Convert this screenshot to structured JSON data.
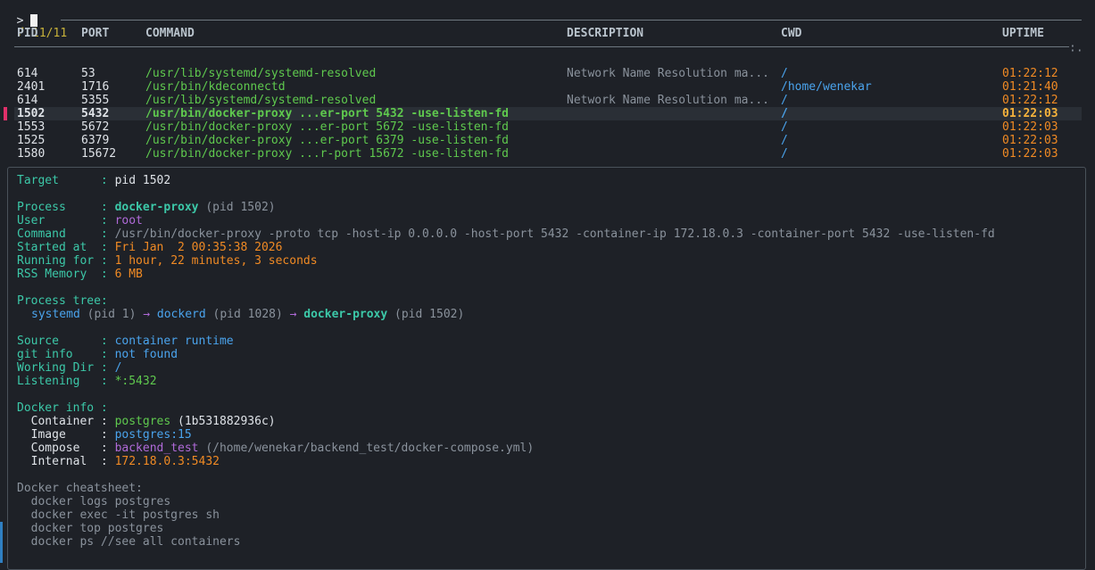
{
  "prompt": {
    "symbol": ">"
  },
  "counter": {
    "icon": "⠌",
    "text": "11/11"
  },
  "columns": [
    "PID",
    "PORT",
    "COMMAND",
    "DESCRIPTION",
    "CWD",
    "UPTIME"
  ],
  "rows": [
    {
      "pid": "614",
      "port": "53",
      "command": "/usr/lib/systemd/systemd-resolved",
      "description": "Network Name Resolution ma...",
      "cwd": "/",
      "uptime": "01:22:12"
    },
    {
      "pid": "2401",
      "port": "1716",
      "command": "/usr/bin/kdeconnectd",
      "description": "",
      "cwd": "/home/wenekar",
      "uptime": "01:21:40"
    },
    {
      "pid": "614",
      "port": "5355",
      "command": "/usr/lib/systemd/systemd-resolved",
      "description": "Network Name Resolution ma...",
      "cwd": "/",
      "uptime": "01:22:12"
    },
    {
      "pid": "1502",
      "port": "5432",
      "command": "/usr/bin/docker-proxy ...er-port 5432 -use-listen-fd",
      "description": "",
      "cwd": "/",
      "uptime": "01:22:03"
    },
    {
      "pid": "1553",
      "port": "5672",
      "command": "/usr/bin/docker-proxy ...er-port 5672 -use-listen-fd",
      "description": "",
      "cwd": "/",
      "uptime": "01:22:03"
    },
    {
      "pid": "1525",
      "port": "6379",
      "command": "/usr/bin/docker-proxy ...er-port 6379 -use-listen-fd",
      "description": "",
      "cwd": "/",
      "uptime": "01:22:03"
    },
    {
      "pid": "1580",
      "port": "15672",
      "command": "/usr/bin/docker-proxy ...r-port 15672 -use-listen-fd",
      "description": "",
      "cwd": "/",
      "uptime": "01:22:03"
    }
  ],
  "detail": {
    "target_label": "Target      :",
    "target_value": "pid 1502",
    "process_label": "Process     :",
    "process_name": "docker-proxy",
    "process_pid": " (pid 1502)",
    "user_label": "User        :",
    "user_value": "root",
    "command_label": "Command     :",
    "command_value": "/usr/bin/docker-proxy -proto tcp -host-ip 0.0.0.0 -host-port 5432 -container-ip 172.18.0.3 -container-port 5432 -use-listen-fd",
    "started_label": "Started at  :",
    "started_value": "Fri Jan  2 00:35:38 2026",
    "running_label": "Running for :",
    "running_value": "1 hour, 22 minutes, 3 seconds",
    "rss_label": "RSS Memory  :",
    "rss_value": "6 MB",
    "tree_label": "Process tree:",
    "tree": {
      "n1": "systemd",
      "p1": " (pid 1) ",
      "arrow": "→",
      "n2": "dockerd",
      "p2": " (pid 1028) ",
      "n3": "docker-proxy",
      "p3": " (pid 1502)"
    },
    "source_label": "Source      :",
    "source_value": "container runtime",
    "git_label": "git info    :",
    "git_value": "not found",
    "wd_label": "Working Dir :",
    "wd_value": "/",
    "listening_label": "Listening   :",
    "listening_value": "*:5432",
    "docker_label": "Docker info :",
    "container_label": "  Container :",
    "container_value": "postgres",
    "container_id": " (1b531882936c)",
    "image_label": "  Image     :",
    "image_value": "postgres:15",
    "compose_label": "  Compose   :",
    "compose_value": "backend_test",
    "compose_path": " (/home/wenekar/backend_test/docker-compose.yml)",
    "internal_label": "  Internal  :",
    "internal_value": "172.18.0.3:5432",
    "cheat_label": "Docker cheatsheet:",
    "cheats": [
      "  docker logs postgres",
      "  docker exec -it postgres sh",
      "  docker top postgres",
      "  docker ps //see all containers"
    ]
  },
  "colors": {
    "accent": "#3cc8a8",
    "selection_marker": "#e0306a",
    "command": "#5fc94e",
    "uptime": "#f08a24",
    "cwd": "#4aa3ec"
  }
}
